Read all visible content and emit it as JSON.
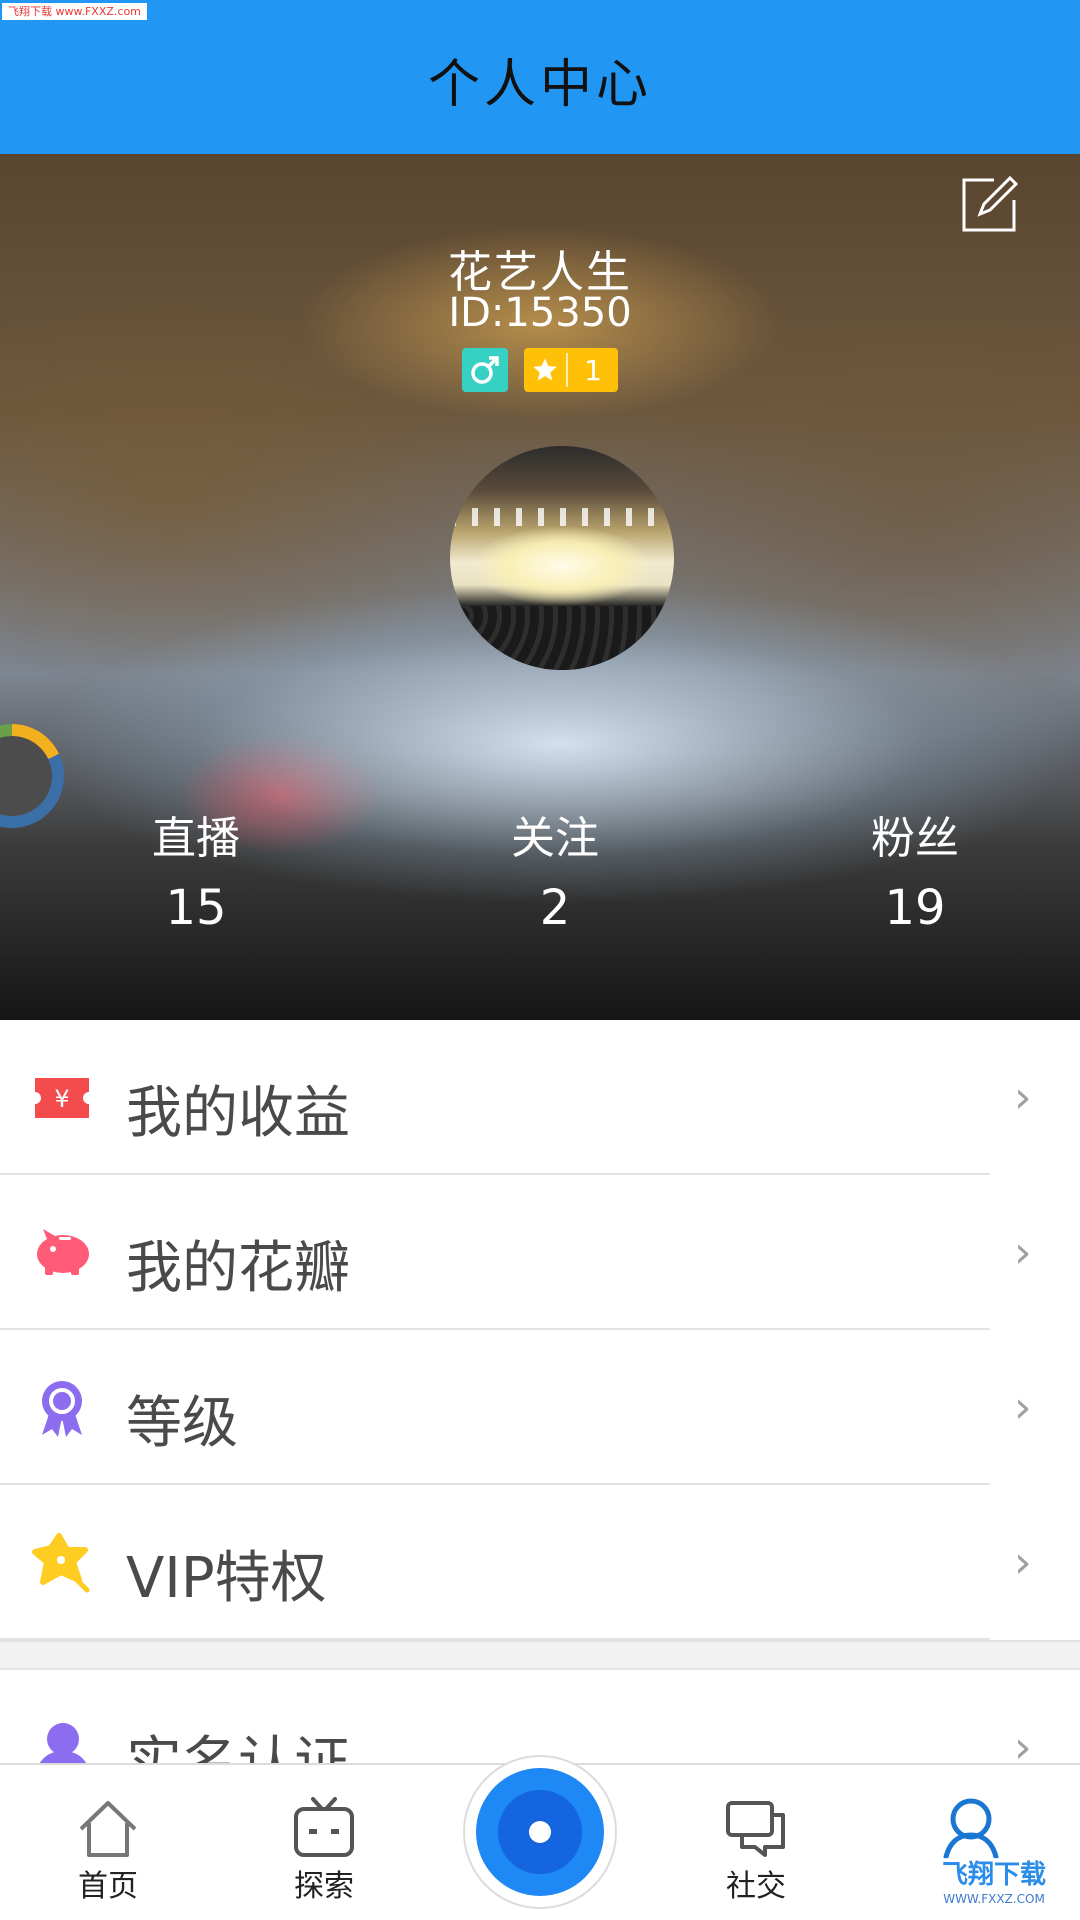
{
  "status_watermark": "飞翔下载 www.FXXZ.com",
  "header": {
    "title": "个人中心"
  },
  "profile": {
    "nickname": "花艺人生",
    "user_id": "ID:15350",
    "gender_icon": "male-icon",
    "level": "1",
    "edit_icon": "edit-icon",
    "stats": [
      {
        "label": "直播",
        "value": "15"
      },
      {
        "label": "关注",
        "value": "2"
      },
      {
        "label": "粉丝",
        "value": "19"
      }
    ]
  },
  "menu": [
    {
      "label": "我的收益",
      "icon": "yen-ticket-icon",
      "color": "#f44c4c"
    },
    {
      "label": "我的花瓣",
      "icon": "piggy-bank-icon",
      "color": "#ff5a78"
    },
    {
      "label": "等级",
      "icon": "medal-icon",
      "color": "#8c6df0"
    },
    {
      "label": "VIP特权",
      "icon": "star-flower-icon",
      "color": "#ffcc22"
    },
    {
      "label": "实名认证",
      "icon": "user-verify-icon",
      "color": "#8c6df0"
    }
  ],
  "bottom_nav": [
    {
      "label": "首页",
      "icon": "home-icon"
    },
    {
      "label": "探索",
      "icon": "tv-icon"
    },
    {
      "label": "",
      "icon": "live-record-icon"
    },
    {
      "label": "社交",
      "icon": "chat-icon"
    },
    {
      "label": "",
      "icon": "profile-icon",
      "active_color": "#1976d2"
    }
  ],
  "footer_watermark": {
    "main": "飞翔下载",
    "sub": "WWW.FXXZ.COM"
  }
}
